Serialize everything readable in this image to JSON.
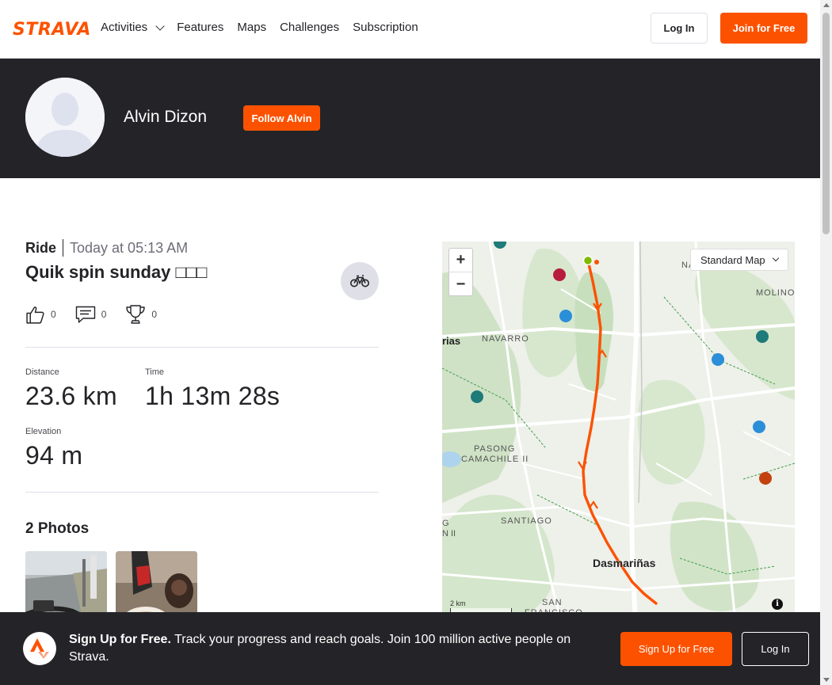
{
  "nav": {
    "logo": "STRAVA",
    "links": [
      "Activities",
      "Features",
      "Maps",
      "Challenges",
      "Subscription"
    ],
    "login_label": "Log In",
    "join_label": "Join for Free"
  },
  "athlete": {
    "name": "Alvin Dizon",
    "follow_label": "Follow Alvin"
  },
  "activity": {
    "type": "Ride",
    "time": "Today at 05:13 AM",
    "title": "Quik spin sunday □□□",
    "kudos": "0",
    "comments": "0",
    "achievements": "0",
    "stats": {
      "distance_label": "Distance",
      "distance_value": "23.6 km",
      "time_label": "Time",
      "time_value": "1h 13m 28s",
      "elevation_label": "Elevation",
      "elevation_value": "94 m"
    },
    "photos_title": "2 Photos"
  },
  "map": {
    "style_label": "Standard Map",
    "zoom_in": "+",
    "zoom_out": "−",
    "scale": "2 km",
    "places": {
      "nap": "NAP",
      "molino": "MOLINO",
      "navarro": "NAVARRO",
      "rias": "rias",
      "pasong": "PASONG",
      "camachile": "CAMACHILE II",
      "santiago": "SANTIAGO",
      "g": "G",
      "nii": "N II",
      "dasmarinas": "Dasmariñas",
      "san": "SAN",
      "francisco": "FRANCISCO"
    },
    "info": "i",
    "colors": {
      "route": "#fc5200",
      "green": "#c8dec0",
      "road": "#ffffff"
    }
  },
  "banner": {
    "headline": "Sign Up for Free.",
    "text": " Track your progress and reach goals. Join 100 million active people on Strava.",
    "signup_label": "Sign Up for Free",
    "login_label": "Log In"
  },
  "colors": {
    "brand": "#fc5200",
    "dark": "#242428"
  }
}
